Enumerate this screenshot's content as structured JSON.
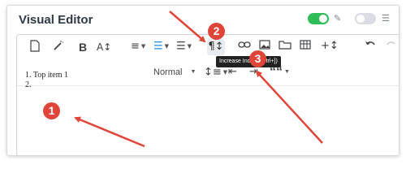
{
  "app": {
    "title": "Visual Editor"
  },
  "header": {
    "toggle_on_color": "#2ebd59",
    "toggle_off_color": "#dadde2",
    "edit_icon": "pencil-icon",
    "settings_icon": "sliders-icon"
  },
  "toolbar1": {
    "new_icon": "document-icon",
    "magic_icon": "magic-wand-icon",
    "bold_label": "B",
    "font_size_label": "A↕",
    "align_label": "≡",
    "ordered_list_label": "☰",
    "bullet_list_label": "☰",
    "paragraph_label": "¶↕",
    "link_icon": "link-icon",
    "image_icon": "image-icon",
    "folder_icon": "folder-icon",
    "table_icon": "table-icon",
    "insert_label": "+↕",
    "undo_icon": "undo-icon",
    "redo_icon": "redo-icon"
  },
  "toolbar2": {
    "format_label": "Normal",
    "line_height_label": "↕≡",
    "outdent_label": "⇤",
    "indent_label": "⇥",
    "quote_label": "““"
  },
  "tooltip": {
    "text": "Increase Indent (Ctrl+])"
  },
  "content": {
    "items": [
      "1. Top item 1",
      "2."
    ]
  },
  "callouts": [
    "1",
    "2",
    "3"
  ],
  "colors": {
    "accent": "#1a8fe3",
    "callout": "#e0453a",
    "arrow": "#e0453a"
  }
}
